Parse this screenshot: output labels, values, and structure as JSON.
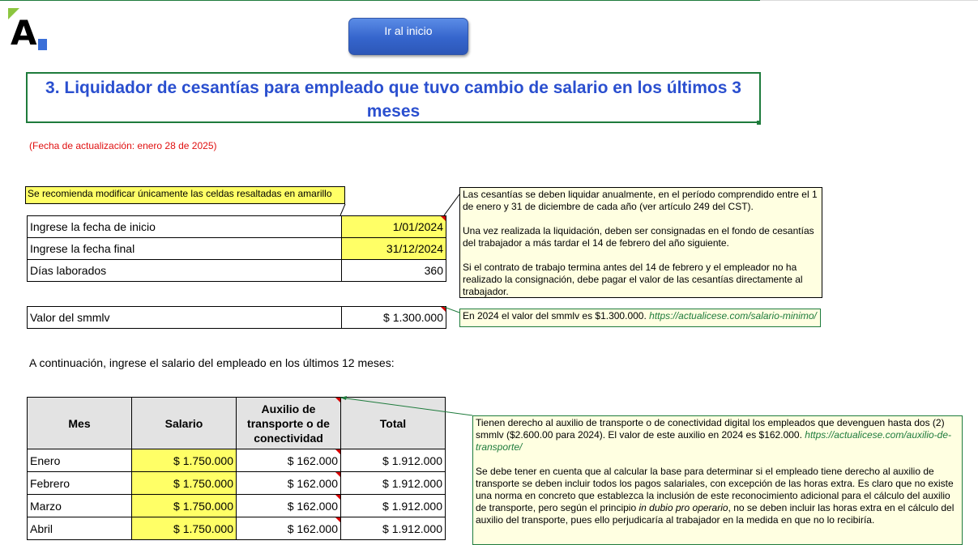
{
  "header": {
    "home_button": "Ir al inicio",
    "title": "3. Liquidador de cesantías para empleado que tuvo cambio de salario en los últimos 3 meses",
    "update_date": "(Fecha de actualización: enero 28 de 2025)"
  },
  "colors": {
    "title": "#2a4fcf",
    "update": "#e01010",
    "editable_cell": "#ffff66",
    "note_bg": "#ffffe1",
    "border_green": "#1e7b3c"
  },
  "recommendation_note": "Se recomienda modificar únicamente las celdas resaltadas en amarillo",
  "dates": {
    "rows": [
      {
        "label": "Ingrese la fecha de inicio",
        "value": "1/01/2024"
      },
      {
        "label": "Ingrese la fecha final",
        "value": "31/12/2024"
      },
      {
        "label": "Días laborados",
        "value": "360"
      }
    ]
  },
  "smmlv": {
    "label": "Valor del smmlv",
    "value": "$ 1.300.000"
  },
  "info_note": {
    "p1": "Las cesantías se deben liquidar anualmente, en el período comprendido entre el 1 de enero y 31 de diciembre de cada año (ver artículo 249 del CST).",
    "p2": "Una vez realizada la liquidación, deben ser consignadas en el fondo de cesantías del trabajador a más tardar el 14 de febrero del año siguiente.",
    "p3": "Si el contrato de trabajo termina antes del 14 de febrero y el empleador no ha realizado la consignación, debe pagar el valor de las cesantías directamente al trabajador."
  },
  "smmlv_note": {
    "text": "En 2024 el valor del smmlv es $1.300.000. ",
    "link": "https://actualicese.com/salario-minimo/"
  },
  "intro": "A continuación, ingrese el salario del empleado en los últimos 12 meses:",
  "salary_table": {
    "headers": [
      "Mes",
      "Salario",
      "Auxilio de transporte o de conectividad",
      "Total"
    ],
    "rows": [
      {
        "month": "Enero",
        "salary": "$ 1.750.000",
        "aux": "$ 162.000",
        "total": "$ 1.912.000"
      },
      {
        "month": "Febrero",
        "salary": "$ 1.750.000",
        "aux": "$ 162.000",
        "total": "$ 1.912.000"
      },
      {
        "month": "Marzo",
        "salary": "$ 1.750.000",
        "aux": "$ 162.000",
        "total": "$ 1.912.000"
      },
      {
        "month": "Abril",
        "salary": "$ 1.750.000",
        "aux": "$ 162.000",
        "total": "$ 1.912.000"
      }
    ]
  },
  "aux_note": {
    "p1": "Tienen derecho al auxilio de transporte o de conectividad digital los empleados que devenguen hasta dos (2) smmlv ($2.600.00 para 2024). El valor de este auxilio en 2024 es $162.000. ",
    "p1_link": "https://actualicese.com/auxilio-de-transporte/",
    "p2a": "Se debe tener en cuenta que al calcular la base para determinar si el empleado tiene derecho al auxilio de transporte se deben incluir todos los pagos salariales, con excepción de las horas extra. Es claro que no existe una norma en concreto que establezca la inclusión de este reconocimiento adicional para el cálculo del auxilio de transporte, pero según el principio ",
    "p2_italic": "in dubio pro operario",
    "p2b": ", no se deben incluir las horas extra en el cálculo del auxilio del transporte, pues ello perjudicaría al trabajador en la medida en que no lo recibiría."
  }
}
